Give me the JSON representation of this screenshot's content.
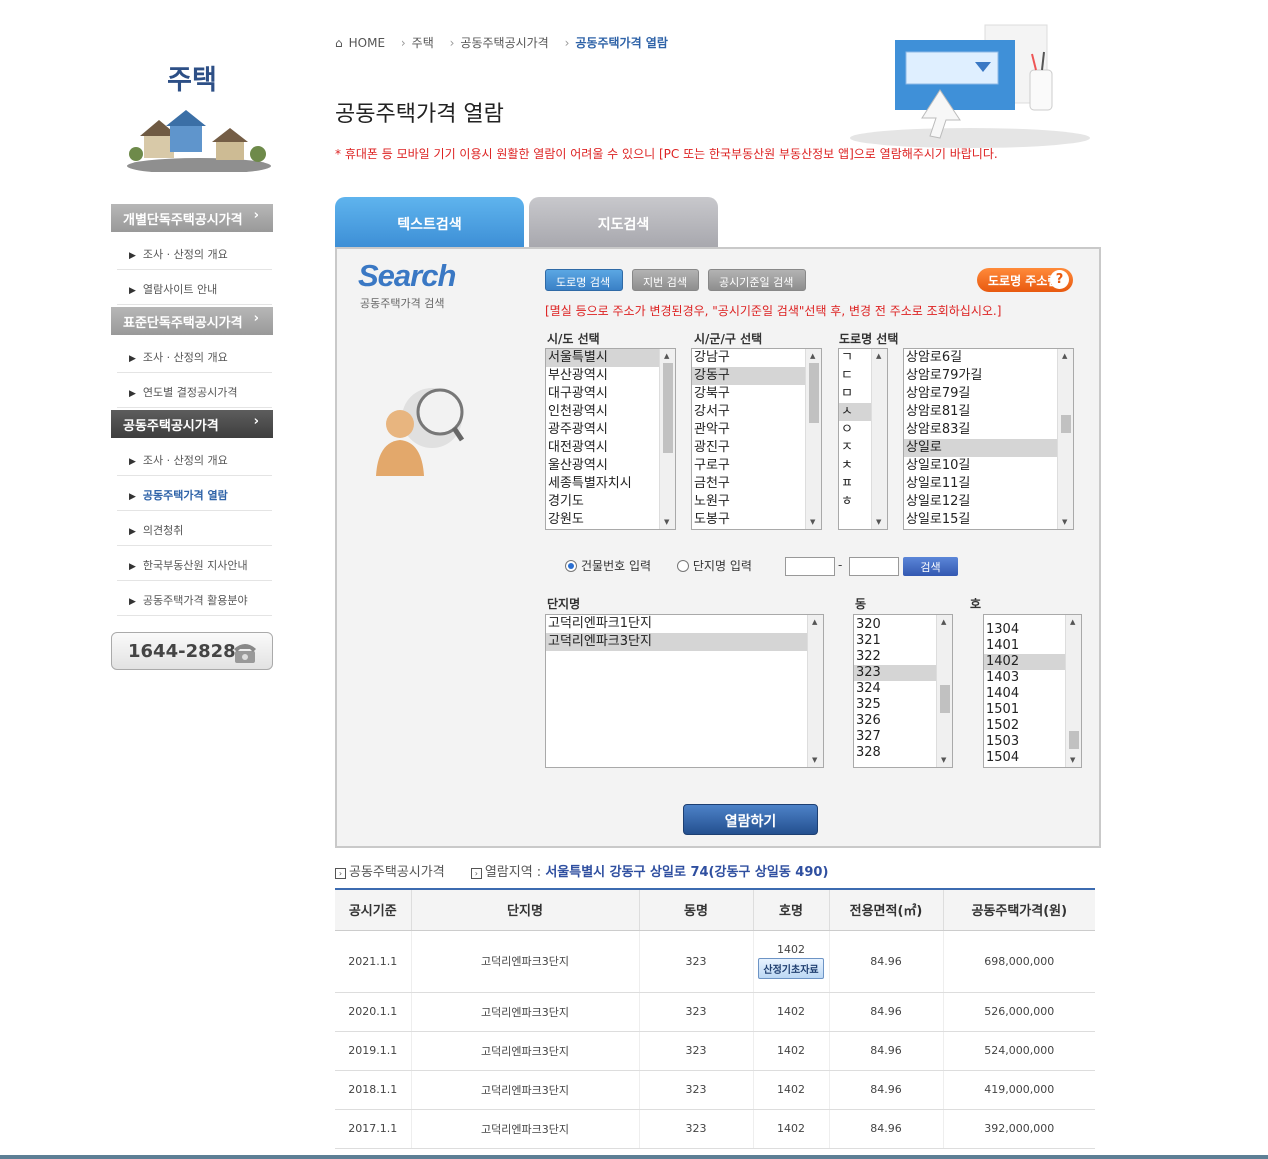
{
  "sidebar": {
    "title": "주택",
    "categories": [
      {
        "label": "개별단독주택공시가격",
        "items": [
          "조사 · 산정의 개요",
          "열람사이트 안내"
        ]
      },
      {
        "label": "표준단독주택공시가격",
        "items": [
          "조사 · 산정의 개요",
          "연도별 결정공시가격"
        ]
      },
      {
        "label": "공동주택공시가격",
        "items": [
          "조사 · 산정의 개요",
          "공동주택가격 열람",
          "의견청취",
          "한국부동산원 지사안내",
          "공동주택가격 활용분야"
        ]
      }
    ],
    "phone": "1644-2828",
    "chev": "›"
  },
  "breadcrumb": {
    "home": "HOME",
    "c1": "주택",
    "c2": "공동주택공시가격",
    "c3": "공동주택가격 열람",
    "sep": "›"
  },
  "page": {
    "title": "공동주택가격 열람",
    "notice": "* 휴대폰 등 모바일 기기 이용시 원활한 열람이 어려울 수 있으니 [PC 또는 한국부동산원 부동산정보 앱]으로 열람해주시기 바랍니다."
  },
  "tabs": {
    "text_search": "텍스트검색",
    "map_search": "지도검색"
  },
  "search": {
    "logo": "Search",
    "logo_sub": "공동주택가격 검색",
    "btn_road": "도로명 검색",
    "btn_lot": "지번 검색",
    "btn_date": "공시기준일 검색",
    "road_help": "도로명 주소란",
    "road_help_icon": "?",
    "warning": "[멸실 등으로 주소가 변경된경우, \"공시기준일 검색\"선택 후, 변경 전 주소로 조회하십시오.]",
    "label_sido": "시/도 선택",
    "label_sigungu": "시/군/구 선택",
    "label_road": "도로명 선택",
    "sido": [
      "서울특별시",
      "부산광역시",
      "대구광역시",
      "인천광역시",
      "광주광역시",
      "대전광역시",
      "울산광역시",
      "세종특별자치시",
      "경기도",
      "강원도"
    ],
    "sigungu": [
      "강남구",
      "강동구",
      "강북구",
      "강서구",
      "관악구",
      "광진구",
      "구로구",
      "금천구",
      "노원구",
      "도봉구"
    ],
    "initials": [
      "ㄱ",
      "ㄷ",
      "ㅁ",
      "ㅅ",
      "ㅇ",
      "ㅈ",
      "ㅊ",
      "ㅍ",
      "ㅎ"
    ],
    "roads": [
      "상암로6길",
      "상암로79가길",
      "상암로79길",
      "상암로81길",
      "상암로83길",
      "상일로",
      "상일로10길",
      "상일로11길",
      "상일로12길",
      "상일로15길"
    ],
    "radio_building": "건물번호 입력",
    "radio_complex": "단지명 입력",
    "dash": "-",
    "go": "검색",
    "label_complex": "단지명",
    "label_dong": "동",
    "label_ho": "호",
    "complexes": [
      "고덕리엔파크1단지",
      "고덕리엔파크3단지"
    ],
    "dongs": [
      "320",
      "321",
      "322",
      "323",
      "324",
      "325",
      "326",
      "327",
      "328"
    ],
    "hos": [
      "1304",
      "1401",
      "1402",
      "1403",
      "1404",
      "1501",
      "1502",
      "1503",
      "1504"
    ],
    "view": "열람하기"
  },
  "results": {
    "hdr1": "공동주택공시가격",
    "hdr2": "열람지역 :",
    "region": "서울특별시 강동구 상일로 74(강동구 상일동 490)",
    "columns": [
      "공시기준",
      "단지명",
      "동명",
      "호명",
      "전용면적(㎡)",
      "공동주택가격(원)"
    ],
    "calc_btn": "산정기초자료",
    "rows": [
      [
        "2021.1.1",
        "고덕리엔파크3단지",
        "323",
        "1402",
        "84.96",
        "698,000,000"
      ],
      [
        "2020.1.1",
        "고덕리엔파크3단지",
        "323",
        "1402",
        "84.96",
        "526,000,000"
      ],
      [
        "2019.1.1",
        "고덕리엔파크3단지",
        "323",
        "1402",
        "84.96",
        "524,000,000"
      ],
      [
        "2018.1.1",
        "고덕리엔파크3단지",
        "323",
        "1402",
        "84.96",
        "419,000,000"
      ],
      [
        "2017.1.1",
        "고덕리엔파크3단지",
        "323",
        "1402",
        "84.96",
        "392,000,000"
      ]
    ]
  }
}
